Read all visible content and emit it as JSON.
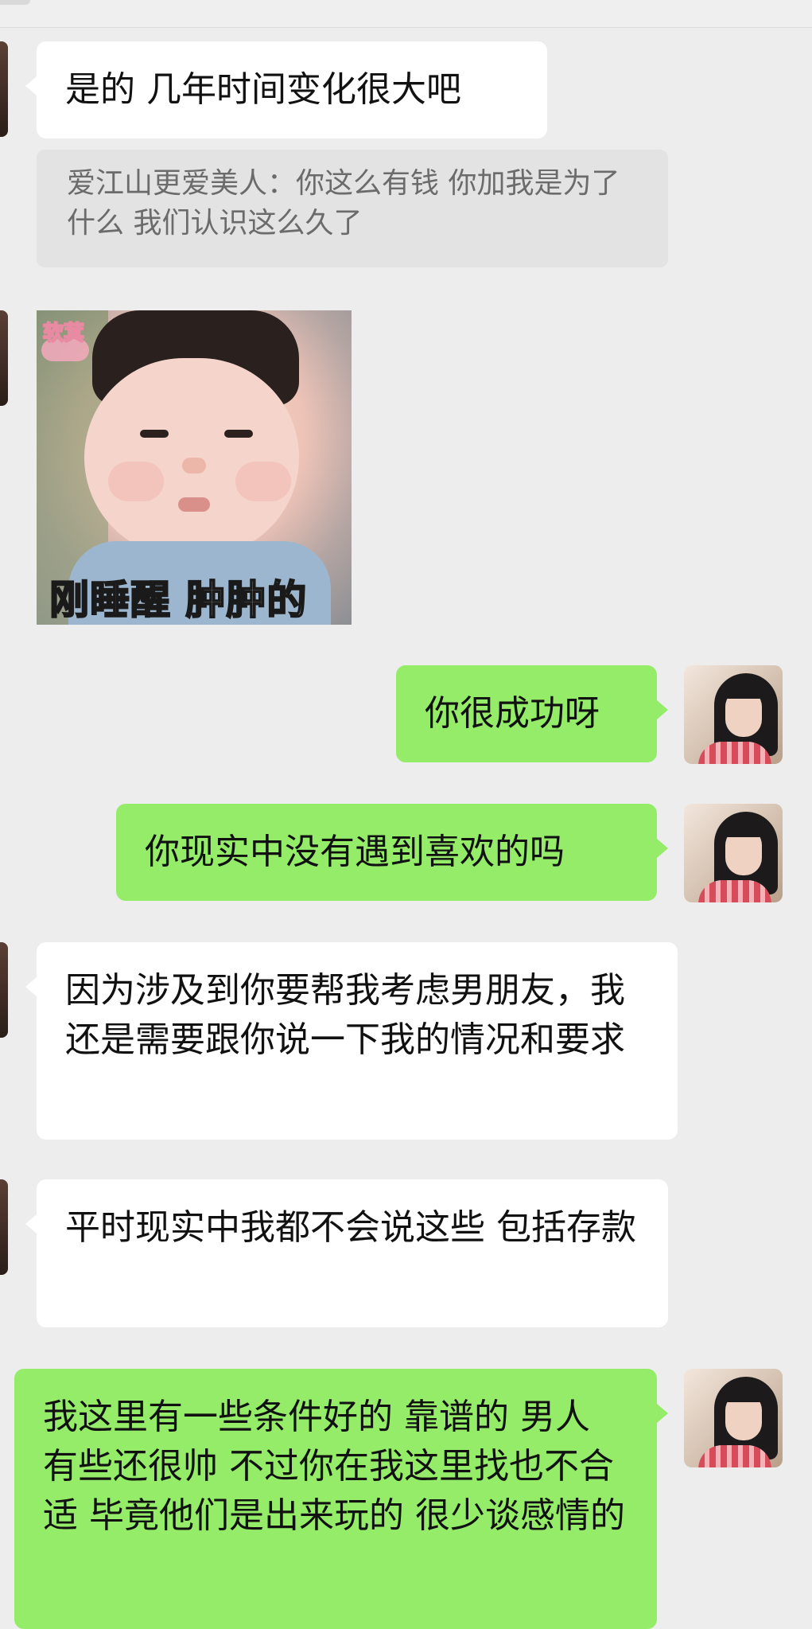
{
  "chat": {
    "messages": [
      {
        "side": "left",
        "text": "是的 几年时间变化很大吧"
      },
      {
        "side": "left",
        "type": "quote",
        "text": "爱江山更爱美人：你这么有钱 你加我是为了什么 我们认识这么久了"
      },
      {
        "side": "left",
        "type": "sticker",
        "caption": "刚睡醒 肿肿的",
        "badge": "软萁"
      },
      {
        "side": "right",
        "text": "你很成功呀"
      },
      {
        "side": "right",
        "text": "你现实中没有遇到喜欢的吗"
      },
      {
        "side": "left",
        "text": "因为涉及到你要帮我考虑男朋友，我还是需要跟你说一下我的情况和要求"
      },
      {
        "side": "left",
        "text": "平时现实中我都不会说这些 包括存款"
      },
      {
        "side": "right",
        "text": "我这里有一些条件好的 靠谱的 男人 有些还很帅 不过你在我这里找也不合适 毕竟他们是出来玩的 很少谈感情的"
      }
    ]
  },
  "colors": {
    "background": "#ededed",
    "left_bubble": "#ffffff",
    "right_bubble": "#95ec69",
    "quote_bg": "#e3e3e3",
    "quote_text": "#6b6b6b"
  },
  "icons": {
    "left_avatar": "avatar",
    "right_avatar": "avatar"
  }
}
